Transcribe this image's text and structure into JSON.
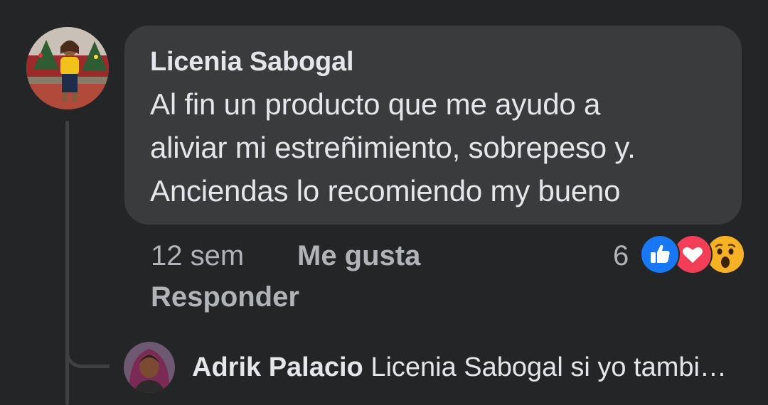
{
  "comment": {
    "author": "Licenia Sabogal",
    "text_lines": [
      "Al fin un producto que me ayudo a",
      "aliviar mi estreñimiento, sobrepeso y.",
      "Anciendas lo recomiendo my bueno"
    ],
    "time": "12 sem",
    "like_label": "Me gusta",
    "reply_label": "Responder",
    "reaction_count": "6",
    "reactions": [
      "like-icon",
      "love-icon",
      "wow-icon"
    ]
  },
  "reply": {
    "author": "Adrik Palacio",
    "text": "Licenia Sabogal  si yo tambi…"
  },
  "colors": {
    "background": "#242526",
    "bubble": "#3a3b3c",
    "primary_text": "#e4e6eb",
    "secondary_text": "#b0b3b8",
    "like_blue": "#1877f2",
    "love_red": "#f33e58",
    "wow_yellow": "#f7b125"
  }
}
